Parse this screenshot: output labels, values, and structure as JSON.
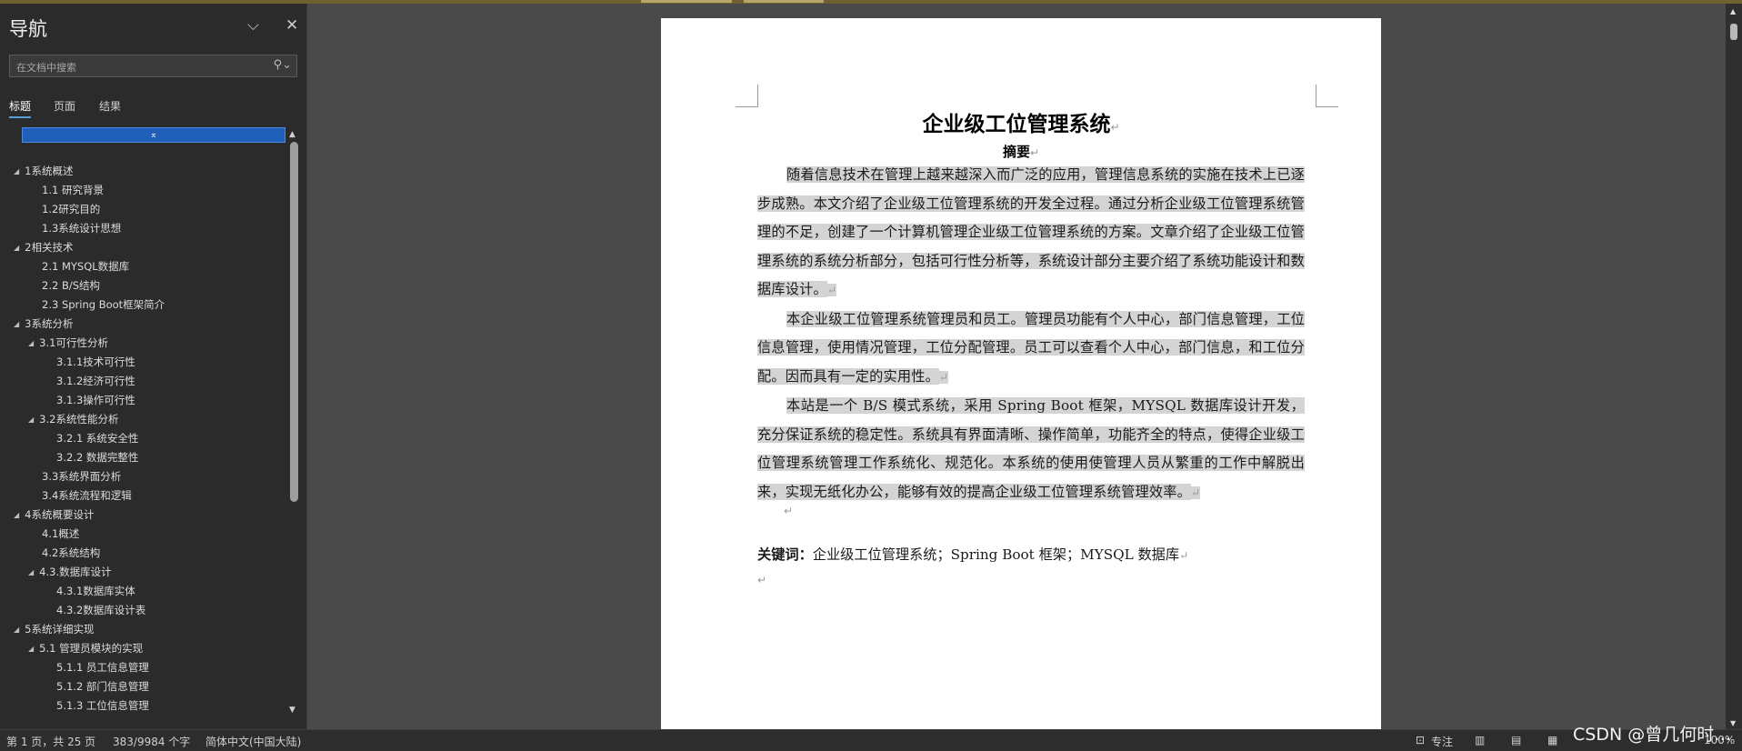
{
  "nav": {
    "title": "导航",
    "search_placeholder": "在文档中搜索",
    "tabs": [
      {
        "label": "标题",
        "active": true
      },
      {
        "label": "页面",
        "active": false
      },
      {
        "label": "结果",
        "active": false
      }
    ],
    "collapse_icon": "collapse-up-icon",
    "tree": [
      {
        "label": "1系统概述",
        "level": 1,
        "expanded": true
      },
      {
        "label": "1.1 研究背景",
        "level": 2
      },
      {
        "label": "1.2研究目的",
        "level": 2
      },
      {
        "label": "1.3系统设计思想",
        "level": 2
      },
      {
        "label": "2相关技术",
        "level": 1,
        "expanded": true
      },
      {
        "label": "2.1 MYSQL数据库",
        "level": 2
      },
      {
        "label": "2.2 B/S结构",
        "level": 2
      },
      {
        "label": "2.3 Spring Boot框架简介",
        "level": 2
      },
      {
        "label": "3系统分析",
        "level": 1,
        "expanded": true
      },
      {
        "label": "3.1可行性分析",
        "level": 2,
        "expanded": true
      },
      {
        "label": "3.1.1技术可行性",
        "level": 3
      },
      {
        "label": "3.1.2经济可行性",
        "level": 3
      },
      {
        "label": "3.1.3操作可行性",
        "level": 3
      },
      {
        "label": "3.2系统性能分析",
        "level": 2,
        "expanded": true
      },
      {
        "label": "3.2.1 系统安全性",
        "level": 3
      },
      {
        "label": "3.2.2 数据完整性",
        "level": 3
      },
      {
        "label": "3.3系统界面分析",
        "level": 2
      },
      {
        "label": "3.4系统流程和逻辑",
        "level": 2
      },
      {
        "label": "4系统概要设计",
        "level": 1,
        "expanded": true
      },
      {
        "label": "4.1概述",
        "level": 2
      },
      {
        "label": "4.2系统结构",
        "level": 2
      },
      {
        "label": "4.3.数据库设计",
        "level": 2,
        "expanded": true
      },
      {
        "label": "4.3.1数据库实体",
        "level": 3
      },
      {
        "label": "4.3.2数据库设计表",
        "level": 3
      },
      {
        "label": "5系统详细实现",
        "level": 1,
        "expanded": true
      },
      {
        "label": "5.1 管理员模块的实现",
        "level": 2,
        "expanded": true
      },
      {
        "label": "5.1.1 员工信息管理",
        "level": 3
      },
      {
        "label": "5.1.2 部门信息管理",
        "level": 3
      },
      {
        "label": "5.1.3 工位信息管理",
        "level": 3
      }
    ]
  },
  "document": {
    "title": "企业级工位管理系统",
    "abstract_heading": "摘要",
    "paragraph_mark": "↵",
    "paragraphs": [
      "随着信息技术在管理上越来越深入而广泛的应用，管理信息系统的实施在技术上已逐步成熟。本文介绍了企业级工位管理系统的开发全过程。通过分析企业级工位管理系统管理的不足，创建了一个计算机管理企业级工位管理系统的方案。文章介绍了企业级工位管理系统的系统分析部分，包括可行性分析等，系统设计部分主要介绍了系统功能设计和数据库设计。",
      "本企业级工位管理系统管理员和员工。管理员功能有个人中心，部门信息管理，工位信息管理，使用情况管理，工位分配管理。员工可以查看个人中心，部门信息，和工位分配。因而具有一定的实用性。",
      "本站是一个 B/S 模式系统，采用 Spring Boot 框架，MYSQL 数据库设计开发，充分保证系统的稳定性。系统具有界面清晰、操作简单，功能齐全的特点，使得企业级工位管理系统管理工作系统化、规范化。本系统的使用使管理人员从繁重的工作中解脱出来，实现无纸化办公，能够有效的提高企业级工位管理系统管理效率。"
    ],
    "keywords_label": "关键词：",
    "keywords_text": "企业级工位管理系统；Spring Boot 框架；MYSQL 数据库"
  },
  "status_bar": {
    "page": "第 1 页，共 25 页",
    "words": "383/9984 个字",
    "language": "简体中文(中国大陆)",
    "focus": "专注",
    "zoom": "100%"
  },
  "watermark": "CSDN @曾几何时…"
}
